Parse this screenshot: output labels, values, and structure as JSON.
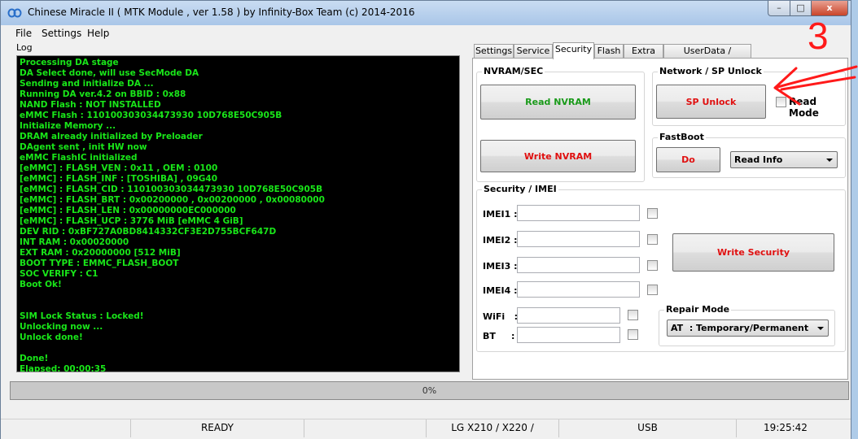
{
  "window": {
    "title": "Chinese Miracle II ( MTK Module , ver 1.58 ) by Infinity-Box Team (c) 2014-2016",
    "controls": {
      "minimize": "–",
      "maximize": "□",
      "close": "x"
    }
  },
  "menu": [
    "File",
    "Settings",
    "Help"
  ],
  "log": {
    "label": "Log",
    "lines": [
      "Processing DA stage",
      "DA Select done, will use SecMode DA",
      "Sending and initialize DA ...",
      "Running DA ver.4.2 on BBID : 0x88",
      "NAND Flash : NOT INSTALLED",
      "eMMC Flash : 110100303034473930 10D768E50C905B",
      "Initialize Memory ...",
      "DRAM already initialized by Preloader",
      "DAgent sent , init HW now",
      "eMMC FlashIC initialized",
      "[eMMC] : FLASH_VEN : 0x11 , OEM : 0100",
      "[eMMC] : FLASH_INF : [TOSHIBA] , 09G40",
      "[eMMC] : FLASH_CID : 110100303034473930 10D768E50C905B",
      "[eMMC] : FLASH_BRT : 0x00200000 , 0x00200000 , 0x00080000",
      "[eMMC] : FLASH_LEN : 0x00000000EC000000",
      "[eMMC] : FLASH_UCP : 3776 MiB [eMMC 4 GiB]",
      "DEV RID    : 0xBF727A0BD8414332CF3E2D755BCF647D",
      "INT RAM    : 0x00020000",
      "EXT RAM    : 0x20000000 [512 MiB]",
      "BOOT TYPE : EMMC_FLASH_BOOT",
      "SOC VERIFY : C1",
      "Boot Ok!",
      "",
      "",
      "SIM Lock Status : Locked!",
      "Unlocking now ...",
      "Unlock done!",
      "",
      "Done!",
      "Elapsed: 00:00:35"
    ]
  },
  "tabs": [
    "Settings",
    "Service",
    "Security",
    "Flash",
    "Extra",
    "UserData / Forensic"
  ],
  "active_tab": "Security",
  "nvram": {
    "title": "NVRAM/SEC",
    "read": "Read NVRAM",
    "write": "Write NVRAM"
  },
  "network": {
    "title": "Network / SP Unlock",
    "unlock": "SP Unlock",
    "read_mode": "Read Mode",
    "read_mode_checked": false
  },
  "fastboot": {
    "title": "FastBoot",
    "do": "Do",
    "selected": "Read Info"
  },
  "security": {
    "title": "Security / IMEI",
    "fields": [
      {
        "label": "IMEI1 :",
        "value": ""
      },
      {
        "label": "IMEI2 :",
        "value": ""
      },
      {
        "label": "IMEI3 :",
        "value": ""
      },
      {
        "label": "IMEI4 :",
        "value": ""
      },
      {
        "label": "WiFi   :",
        "value": ""
      },
      {
        "label": "BT     :",
        "value": ""
      }
    ],
    "write": "Write Security"
  },
  "repair": {
    "title": "Repair Mode",
    "selected": "AT  : Temporary/Permanent"
  },
  "progress": {
    "text": "0%",
    "value": 0
  },
  "status": {
    "state": "READY",
    "model": "LG X210 / X220 /",
    "port": "USB",
    "time": "19:25:42"
  },
  "annotation": {
    "number": "3",
    "color": "#ff1a1a"
  },
  "colors": {
    "log_text": "#19e619",
    "log_bg": "#000000",
    "green_button": "#1a9a1a",
    "red_button": "#e01010"
  }
}
